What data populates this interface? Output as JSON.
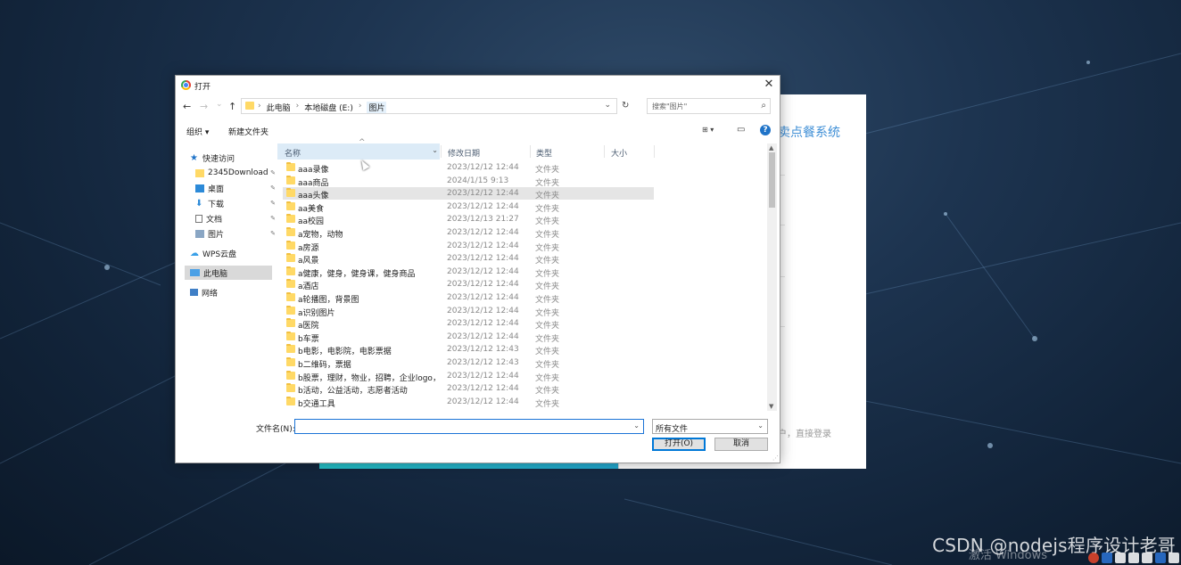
{
  "background": {
    "app_title": "卖点餐系统",
    "login_hint": "户，直接登录",
    "watermark": "CSDN @nodejs程序设计老哥",
    "activation": "激活 Windows"
  },
  "dialog": {
    "title": "打开",
    "close_label": "✕",
    "nav": {
      "back": "←",
      "forward": "→",
      "recent": "⌄",
      "up": "↑",
      "refresh": "↻"
    },
    "breadcrumb": [
      "此电脑",
      "本地磁盘 (E:)",
      "图片"
    ],
    "search_placeholder": "搜索\"图片\"",
    "toolbar": {
      "organize": "组织 ▾",
      "new_folder": "新建文件夹",
      "view": "⊞ ▾",
      "pane": "▭",
      "help": "?"
    },
    "nav_pane": {
      "quick_access": "快速访问",
      "pinned": [
        "2345Download",
        "桌面",
        "下载",
        "文档",
        "图片"
      ],
      "wps": "WPS云盘",
      "this_pc": "此电脑",
      "network": "网络"
    },
    "columns": {
      "name": "名称",
      "date": "修改日期",
      "type": "类型",
      "size": "大小"
    },
    "files": [
      {
        "name": "aaa录像",
        "date": "2023/12/12 12:44",
        "type": "文件夹"
      },
      {
        "name": "aaa商品",
        "date": "2024/1/15 9:13",
        "type": "文件夹"
      },
      {
        "name": "aaa头像",
        "date": "2023/12/12 12:44",
        "type": "文件夹"
      },
      {
        "name": "aa美食",
        "date": "2023/12/12 12:44",
        "type": "文件夹"
      },
      {
        "name": "aa校园",
        "date": "2023/12/13 21:27",
        "type": "文件夹"
      },
      {
        "name": "a宠物，动物",
        "date": "2023/12/12 12:44",
        "type": "文件夹"
      },
      {
        "name": "a房源",
        "date": "2023/12/12 12:44",
        "type": "文件夹"
      },
      {
        "name": "a风景",
        "date": "2023/12/12 12:44",
        "type": "文件夹"
      },
      {
        "name": "a健康，健身，健身课，健身商品",
        "date": "2023/12/12 12:44",
        "type": "文件夹"
      },
      {
        "name": "a酒店",
        "date": "2023/12/12 12:44",
        "type": "文件夹"
      },
      {
        "name": "a轮播图，背景图",
        "date": "2023/12/12 12:44",
        "type": "文件夹"
      },
      {
        "name": "a识别图片",
        "date": "2023/12/12 12:44",
        "type": "文件夹"
      },
      {
        "name": "a医院",
        "date": "2023/12/12 12:44",
        "type": "文件夹"
      },
      {
        "name": "b车票",
        "date": "2023/12/12 12:44",
        "type": "文件夹"
      },
      {
        "name": "b电影，电影院，电影票据",
        "date": "2023/12/12 12:43",
        "type": "文件夹"
      },
      {
        "name": "b二维码，票据",
        "date": "2023/12/12 12:43",
        "type": "文件夹"
      },
      {
        "name": "b股票，理财，物业，招聘，企业logo，...",
        "date": "2023/12/12 12:44",
        "type": "文件夹"
      },
      {
        "name": "b活动，公益活动，志愿者活动",
        "date": "2023/12/12 12:44",
        "type": "文件夹"
      },
      {
        "name": "b交通工具",
        "date": "2023/12/12 12:44",
        "type": "文件夹"
      }
    ],
    "filename_label": "文件名(N):",
    "filename_value": "",
    "filetype": "所有文件",
    "open_button": "打开(O)",
    "cancel_button": "取消"
  }
}
